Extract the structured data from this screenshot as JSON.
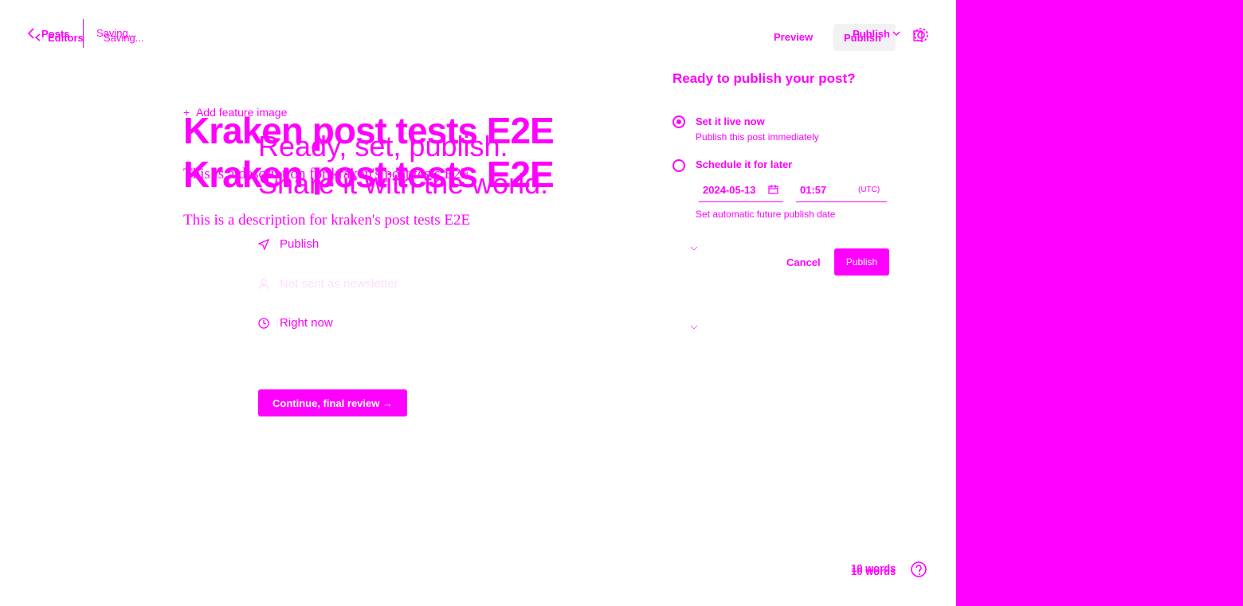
{
  "colors": {
    "accent": "#ff00ff",
    "background": "#ffffff",
    "pill": "#f2f2f4"
  },
  "topbar": {
    "back_label_a": "Posts",
    "back_label_b": "Editors",
    "status_a": "Saving...",
    "status_b": "Saving...",
    "preview_label": "Preview",
    "publish_dropdown_label": "Publish",
    "publish_button_label": "Publish",
    "settings_icon": "gear-icon"
  },
  "editor": {
    "add_feature_image": "Add feature image",
    "title_a": "Kraken post tests E2E",
    "title_b": "Kraken post tests E2E",
    "excerpt_a": "This is a description for kraken's post tests E2E",
    "excerpt_b": "This is a description for kraken's post tests E2E",
    "word_count_a": "10 words",
    "word_count_b": "10 words",
    "help_icon": "help-icon"
  },
  "publish_flow": {
    "headline_line1": "Ready, set, publish.",
    "headline_line2": "Share it with the world.",
    "options": [
      {
        "icon": "send-icon",
        "label": "Publish"
      },
      {
        "icon": "user-icon",
        "label": "Not sent as newsletter"
      },
      {
        "icon": "clock-icon",
        "label": "Right now"
      }
    ],
    "continue_label": "Continue, final review →"
  },
  "schedule_panel": {
    "title": "Ready to publish your post?",
    "option_now_title": "Set it live now",
    "option_now_desc": "Publish this post immediately",
    "option_later_title": "Schedule it for later",
    "date_value": "2024-05-13",
    "time_value": "01:57",
    "timezone": "(UTC)",
    "later_desc": "Set automatic future publish date",
    "cancel_label": "Cancel",
    "publish_label": "Publish"
  }
}
